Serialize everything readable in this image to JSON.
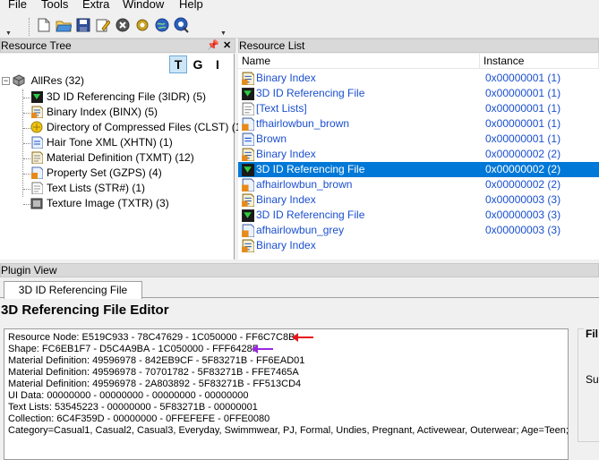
{
  "menu": [
    "File",
    "Tools",
    "Extra",
    "Window",
    "Help"
  ],
  "toolbar": {
    "icons": [
      "new-icon",
      "open-icon",
      "save-icon",
      "edit-icon",
      "close-icon",
      "gear-icon",
      "globe-icon",
      "help-icon"
    ]
  },
  "resource_tree": {
    "title": "Resource Tree",
    "tabs": [
      "T",
      "G",
      "I"
    ],
    "root": "AllRes (32)",
    "items": [
      {
        "label": "3D ID Referencing File (3IDR) (5)",
        "icon": "3idr-icon"
      },
      {
        "label": "Binary Index (BINX) (5)",
        "icon": "binx-icon"
      },
      {
        "label": "Directory of Compressed Files (CLST) (1)",
        "icon": "clst-icon"
      },
      {
        "label": "Hair Tone XML (XHTN) (1)",
        "icon": "xhtn-icon"
      },
      {
        "label": "Material Definition (TXMT) (12)",
        "icon": "txmt-icon"
      },
      {
        "label": "Property Set (GZPS) (4)",
        "icon": "gzps-icon"
      },
      {
        "label": "Text Lists (STR#) (1)",
        "icon": "str-icon"
      },
      {
        "label": "Texture Image (TXTR) (3)",
        "icon": "txtr-icon"
      }
    ]
  },
  "resource_list": {
    "title": "Resource List",
    "columns": [
      "Name",
      "Instance"
    ],
    "rows": [
      {
        "name": "Binary Index",
        "instance": "0x00000001 (1)",
        "icon": "binx-icon"
      },
      {
        "name": "3D ID Referencing File",
        "instance": "0x00000001 (1)",
        "icon": "3idr-icon"
      },
      {
        "name": "[Text Lists]",
        "instance": "0x00000001 (1)",
        "icon": "str-icon"
      },
      {
        "name": "tfhairlowbun_brown",
        "instance": "0x00000001 (1)",
        "icon": "gzps-icon"
      },
      {
        "name": "Brown",
        "instance": "0x00000001 (1)",
        "icon": "xhtn-icon"
      },
      {
        "name": "Binary Index",
        "instance": "0x00000002 (2)",
        "icon": "binx-icon"
      },
      {
        "name": "3D ID Referencing File",
        "instance": "0x00000002 (2)",
        "icon": "3idr-icon",
        "selected": true
      },
      {
        "name": "afhairlowbun_brown",
        "instance": "0x00000002 (2)",
        "icon": "gzps-icon"
      },
      {
        "name": "Binary Index",
        "instance": "0x00000003 (3)",
        "icon": "binx-icon"
      },
      {
        "name": "3D ID Referencing File",
        "instance": "0x00000003 (3)",
        "icon": "3idr-icon"
      },
      {
        "name": "afhairlowbun_grey",
        "instance": "0x00000003 (3)",
        "icon": "gzps-icon"
      },
      {
        "name": "Binary Index",
        "instance": "",
        "icon": "binx-icon"
      }
    ]
  },
  "plugin_view": {
    "title": "Plugin View",
    "tab": "3D ID Referencing File",
    "editor_title": "3D Referencing File Editor",
    "lines": [
      "Resource Node: E519C933 - 78C47629 - 1C050000 - FF6C7C8B",
      "Shape: FC6EB1F7 - D5C4A9BA - 1C050000 - FFF6428F",
      "Material Definition: 49596978 - 842EB9CF - 5F83271B - FF6EAD01",
      "Material Definition: 49596978 - 70701782 - 5F83271B - FFE7465A",
      "Material Definition: 49596978 - 2A803892 - 5F83271B - FF513CD4",
      "UI Data: 00000000 - 00000000 - 00000000 - 00000000",
      "Text Lists: 53545223 - 00000000 - 5F83271B - 00000001",
      "Collection: 6C4F359D - 00000000 - 0FFEFEFE - 0FFE0080",
      "Category=Casual1, Casual2, Casual3, Everyday, Swimmwear, PJ, Formal, Undies, Pregnant, Activewear, Outerwear; Age=Teen;"
    ],
    "side_group_label": "Fil",
    "side_label": "Su"
  },
  "colors": {
    "selection": "#0078d7",
    "link_text": "#1a4fcf",
    "arrow_red": "#e8141c",
    "arrow_purple": "#9b28e0"
  }
}
